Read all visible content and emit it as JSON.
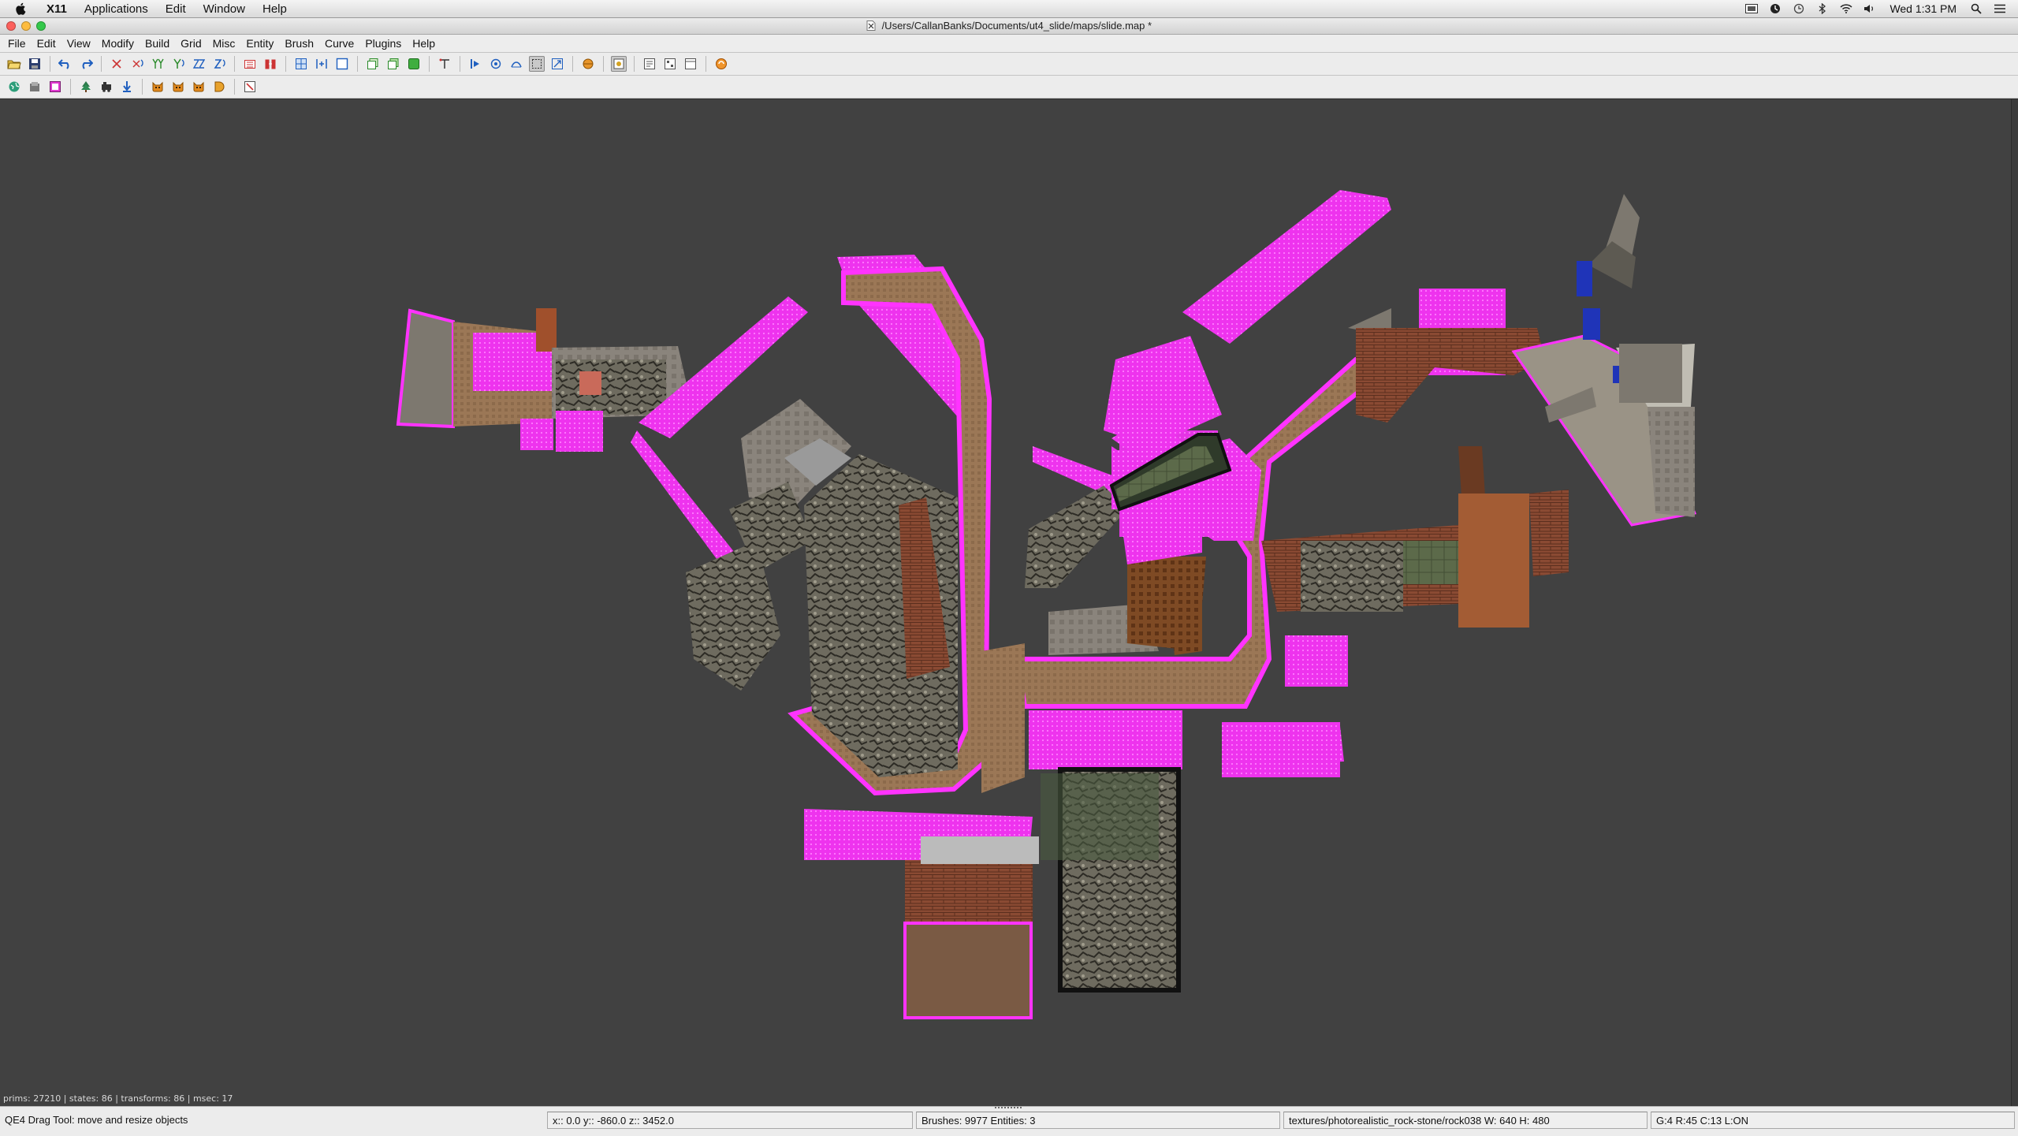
{
  "menubar": {
    "apple_icon": "apple-icon",
    "items": [
      "X11",
      "Applications",
      "Edit",
      "Window",
      "Help"
    ],
    "clock": "Wed 1:31 PM",
    "status_icons": [
      "screen-icon",
      "timemachine-icon",
      "clock-sync-icon",
      "bluetooth-icon",
      "wifi-icon",
      "volume-icon",
      "spotlight-icon",
      "list-icon"
    ]
  },
  "window": {
    "title": "/Users/CallanBanks/Documents/ut4_slide/maps/slide.map *",
    "traffic_lights": {
      "close": "#fc605c",
      "minimize": "#fdbc40",
      "zoom": "#34c84a"
    }
  },
  "app_menu": [
    "File",
    "Edit",
    "View",
    "Modify",
    "Build",
    "Grid",
    "Misc",
    "Entity",
    "Brush",
    "Curve",
    "Plugins",
    "Help"
  ],
  "viewport": {
    "background": "#414141",
    "stats": "prims: 27210 | states: 86 | transforms: 86 | msec: 17",
    "accent_caulk": "#ff33ff",
    "accent_wood": "#9b7756"
  },
  "statusbar": {
    "tool": "QE4 Drag Tool: move and resize objects",
    "coords": "x::   0.0  y:: -860.0  z:: 3452.0",
    "counts": "Brushes: 9977 Entities: 3",
    "texture": "textures/photorealistic_rock-stone/rock038 W: 640 H: 480",
    "grid": "G:4  R:45  C:13  L:ON"
  }
}
